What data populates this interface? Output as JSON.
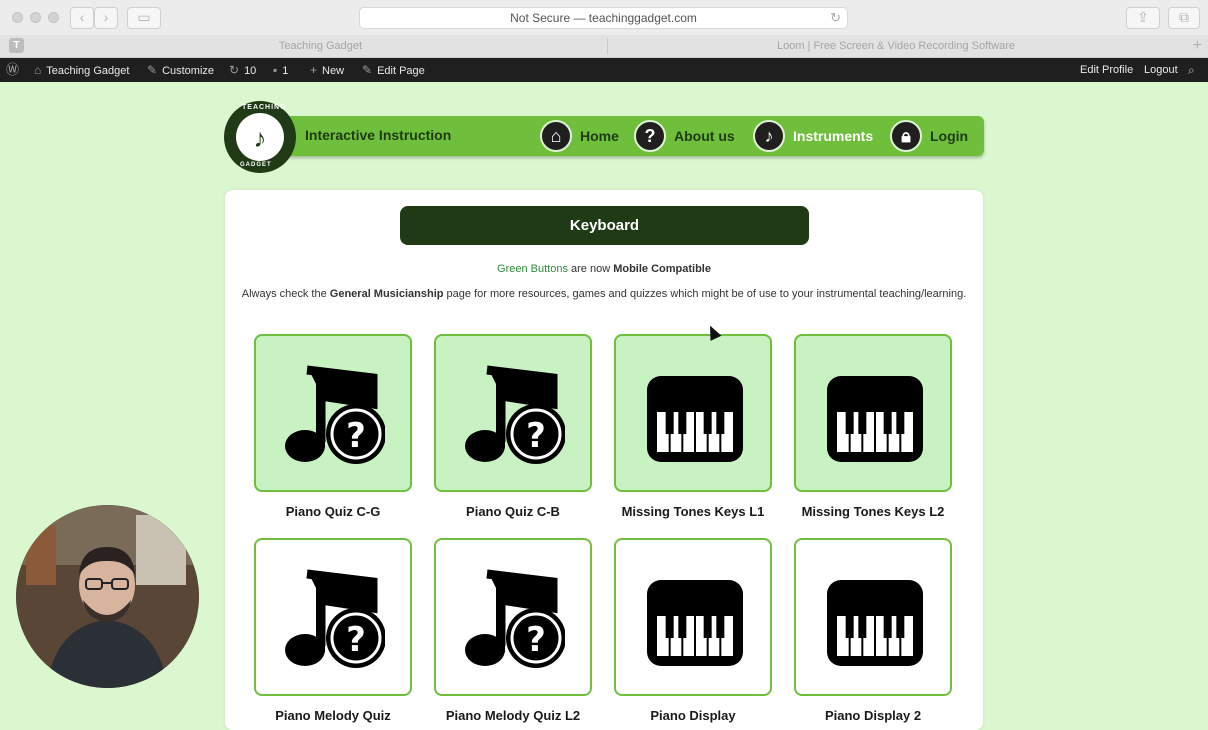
{
  "browser": {
    "url_text": "Not Secure — teachinggadget.com",
    "pinned_tab": "T",
    "tabs": [
      "Teaching Gadget",
      "Loom | Free Screen & Video Recording Software"
    ]
  },
  "admin_bar": {
    "site": "Teaching Gadget",
    "customize": "Customize",
    "updates": "10",
    "comments": "1",
    "new": "New",
    "edit_page": "Edit Page",
    "edit_profile": "Edit Profile",
    "logout": "Logout"
  },
  "site": {
    "logo_text_top": "TEACHING",
    "logo_text_side": "GADGET",
    "tagline": "Interactive Instruction",
    "nav": [
      {
        "label": "Home",
        "icon": "home-icon"
      },
      {
        "label": "About us",
        "icon": "question-icon"
      },
      {
        "label": "Instruments",
        "icon": "music-note-icon"
      },
      {
        "label": "Login",
        "icon": "lock-icon"
      }
    ],
    "nav_active_color": "#ffffff",
    "nav_text_color": "#1f3a15",
    "accent_color": "#6fbf3c",
    "dark_color": "#1f3a15"
  },
  "page": {
    "title": "Keyboard",
    "notice_green": "Green Buttons",
    "notice_mid": " are now ",
    "notice_bold": "Mobile Compatible",
    "info_pre": "Always check the ",
    "info_bold": "General Musicianship",
    "info_post": " page for more resources, games and quizzes which might be of use to your instrumental teaching/learning."
  },
  "tiles": [
    {
      "label": "Piano Quiz C-G",
      "icon": "music-quiz-icon",
      "green": true
    },
    {
      "label": "Piano Quiz C-B",
      "icon": "music-quiz-icon",
      "green": true
    },
    {
      "label": "Missing Tones Keys L1",
      "icon": "piano-keys-icon",
      "green": true
    },
    {
      "label": "Missing Tones Keys L2",
      "icon": "piano-keys-icon",
      "green": true
    },
    {
      "label": "Piano Melody Quiz",
      "icon": "music-quiz-icon",
      "green": false
    },
    {
      "label": "Piano Melody Quiz L2",
      "icon": "music-quiz-icon",
      "green": false
    },
    {
      "label": "Piano Display",
      "icon": "piano-keys-icon",
      "green": false
    },
    {
      "label": "Piano Display 2",
      "icon": "piano-keys-icon",
      "green": false
    }
  ]
}
